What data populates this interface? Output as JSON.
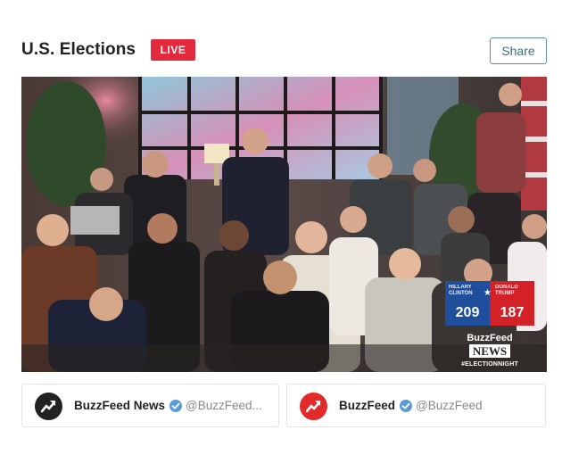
{
  "header": {
    "title": "U.S. Elections",
    "live_label": "LIVE",
    "share_label": "Share"
  },
  "video": {
    "overlay": {
      "left_candidate": "HILLARY CLINTON",
      "right_candidate": "DONALD TRUMP",
      "left_score": "209",
      "right_score": "187",
      "brand_name": "BuzzFeed",
      "brand_news": "NEWS",
      "hashtag": "#ELECTIONNIGHT"
    }
  },
  "accounts": [
    {
      "name": "BuzzFeed News",
      "handle": "@BuzzFeed...",
      "avatar_icon": "trending-arrow-icon",
      "avatar_color": "#222222"
    },
    {
      "name": "BuzzFeed",
      "handle": "@BuzzFeed",
      "avatar_icon": "trending-arrow-icon",
      "avatar_color": "#e32a2a"
    }
  ],
  "colors": {
    "live_red": "#e32a3d",
    "share_border": "#5a8ea7",
    "score_blue": "#1f4e9c",
    "score_red": "#d42027",
    "verified_blue": "#5b9bd5"
  }
}
